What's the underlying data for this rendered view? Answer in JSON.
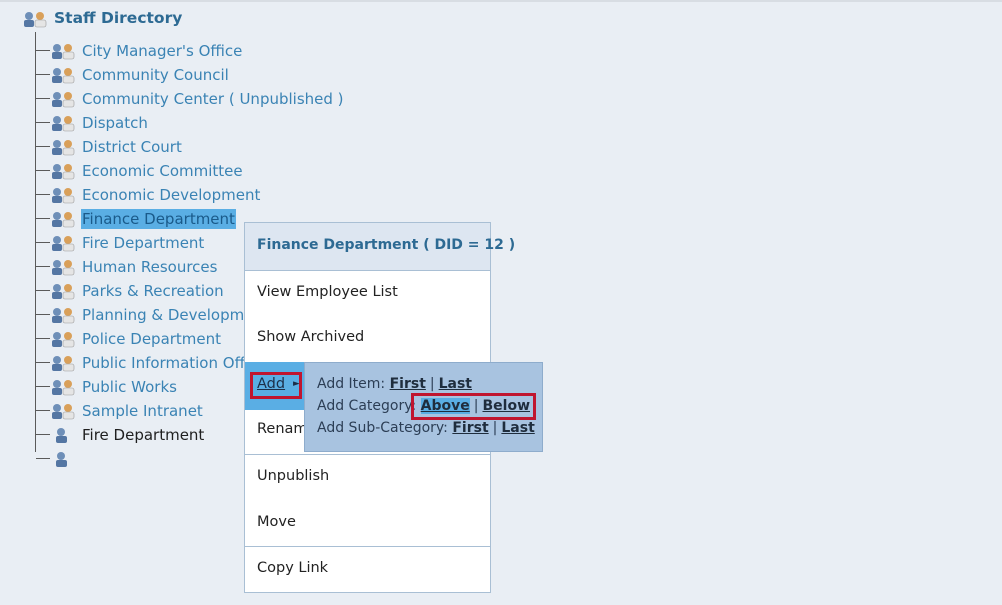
{
  "tree": {
    "root": "Staff Directory",
    "items": [
      {
        "label": "City Manager's Office"
      },
      {
        "label": "Community Council"
      },
      {
        "label": "Community Center ( Unpublished )"
      },
      {
        "label": "Dispatch"
      },
      {
        "label": "District Court"
      },
      {
        "label": "Economic Committee"
      },
      {
        "label": "Economic Development"
      },
      {
        "label": "Finance Department"
      },
      {
        "label": "Fire Department"
      },
      {
        "label": "Human Resources"
      },
      {
        "label": "Parks & Recreation"
      },
      {
        "label": "Planning & Developme"
      },
      {
        "label": "Police Department"
      },
      {
        "label": "Public Information Off"
      },
      {
        "label": "Public Works"
      },
      {
        "label": "Sample Intranet"
      },
      {
        "label": "Fire Department"
      }
    ]
  },
  "context_menu": {
    "title": "Finance Department ( DID = 12 )",
    "view_employees": "View Employee List",
    "show_archived": "Show Archived",
    "add": "Add",
    "rename": "Renam",
    "unpublish": "Unpublish",
    "move": "Move",
    "copy_link": "Copy Link"
  },
  "submenu": {
    "add_item": "Add Item:",
    "add_category": "Add Category:",
    "add_subcategory": "Add Sub-Category:",
    "first": "First",
    "last": "Last",
    "above": "Above",
    "below": "Below",
    "sep": "|"
  },
  "colors": {
    "selected": "#5aaee4",
    "highlight_box": "#c0152f",
    "link": "#3a83b4"
  }
}
